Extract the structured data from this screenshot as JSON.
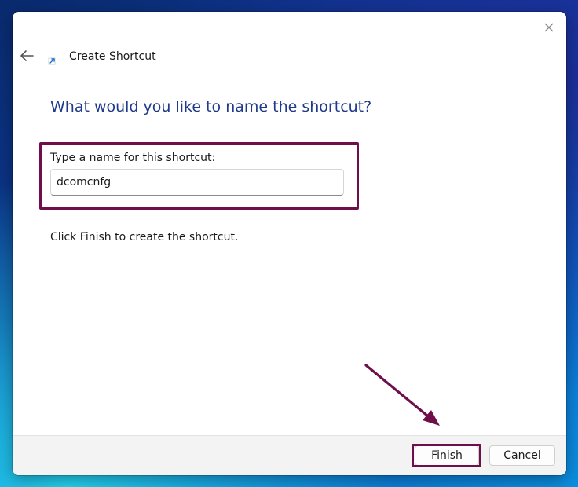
{
  "window": {
    "title": "Create Shortcut",
    "close_icon": "close-icon",
    "back_icon": "arrow-left-icon",
    "title_icon": "shortcut-arrow-icon"
  },
  "main": {
    "heading": "What would you like to name the shortcut?",
    "name_label": "Type a name for this shortcut:",
    "name_value": "dcomcnfg",
    "info_text": "Click Finish to create the shortcut."
  },
  "footer": {
    "finish_label": "Finish",
    "cancel_label": "Cancel"
  },
  "colors": {
    "heading": "#1f3a8a",
    "highlight": "#6e0f4b",
    "footer_bg": "#f3f3f3"
  }
}
